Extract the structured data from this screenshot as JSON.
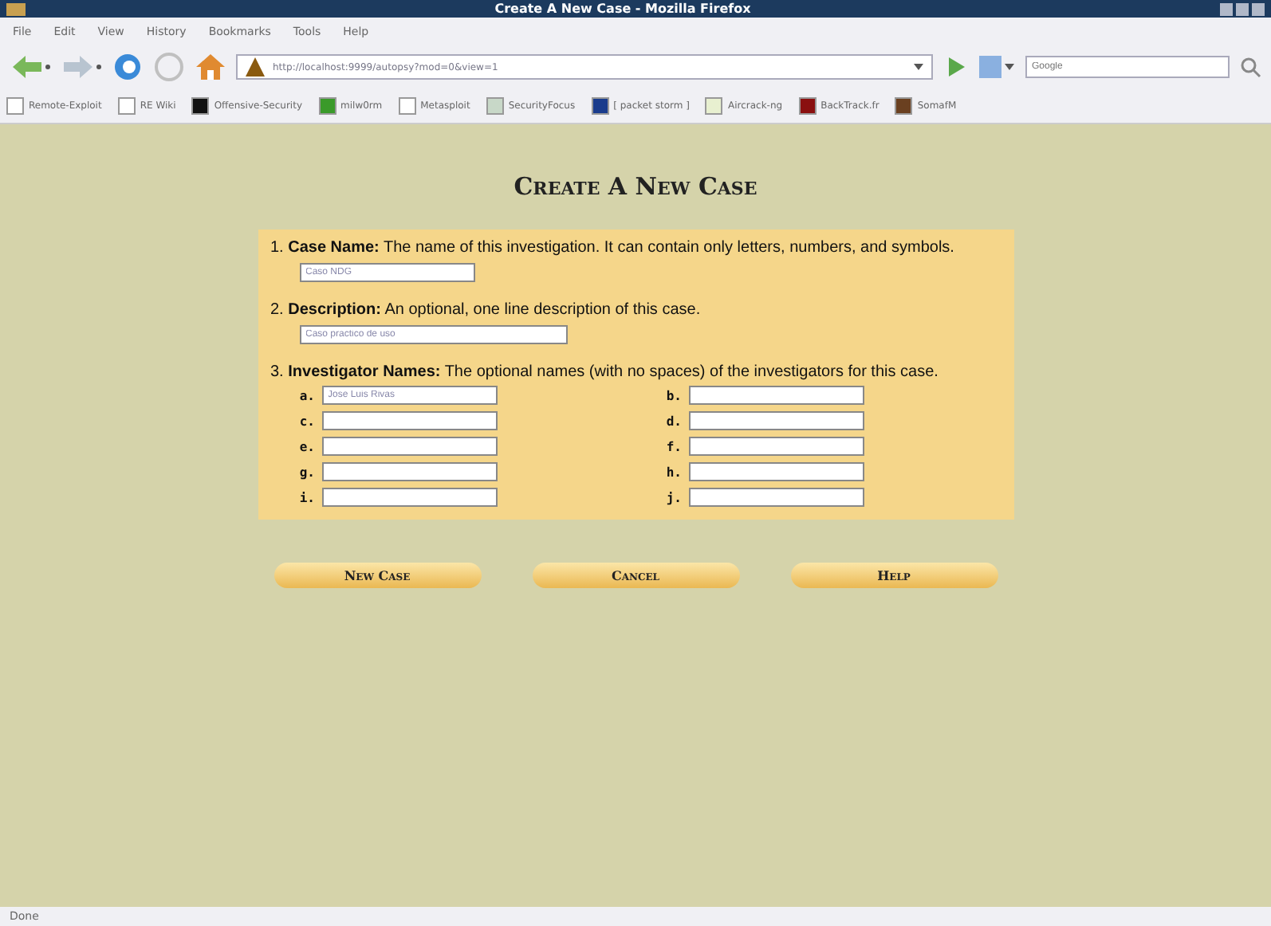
{
  "window": {
    "title": "Create A New Case - Mozilla Firefox"
  },
  "menu": [
    "File",
    "Edit",
    "View",
    "History",
    "Bookmarks",
    "Tools",
    "Help"
  ],
  "address": {
    "value": "http://localhost:9999/autopsy?mod=0&view=1"
  },
  "search": {
    "placeholder": "Google"
  },
  "bookmarks": [
    {
      "label": "Remote-Exploit",
      "kind": "page"
    },
    {
      "label": "RE Wiki",
      "kind": "page"
    },
    {
      "label": "Offensive-Security",
      "kind": "dark"
    },
    {
      "label": "milw0rm",
      "kind": "green"
    },
    {
      "label": "Metasploit",
      "kind": "page"
    },
    {
      "label": "SecurityFocus",
      "kind": "focus"
    },
    {
      "label": "[ packet storm ]",
      "kind": "blue"
    },
    {
      "label": "Aircrack-ng",
      "kind": "aircrack"
    },
    {
      "label": "BackTrack.fr",
      "kind": "red"
    },
    {
      "label": "SomafM",
      "kind": "brown"
    }
  ],
  "heading": "Create A New Case",
  "sections": [
    {
      "number": "1.",
      "title": "Case Name:",
      "text": "The name of this investigation. It can contain only letters, numbers, and symbols.",
      "value": "Caso NDG",
      "kind": "short"
    },
    {
      "number": "2.",
      "title": "Description:",
      "text": "An optional, one line description of this case.",
      "value": "Caso practico de uso",
      "kind": "long"
    },
    {
      "number": "3.",
      "title": "Investigator Names:",
      "text": "The optional names (with no spaces) of the investigators for this case.",
      "kind": "names"
    }
  ],
  "investigators": [
    {
      "label": "a.",
      "value": "Jose Luis Rivas"
    },
    {
      "label": "b."
    },
    {
      "label": "c."
    },
    {
      "label": "d."
    },
    {
      "label": "e."
    },
    {
      "label": "f."
    },
    {
      "label": "g."
    },
    {
      "label": "h."
    },
    {
      "label": "i."
    },
    {
      "label": "j."
    }
  ],
  "buttons": [
    "New Case",
    "Cancel",
    "Help"
  ],
  "status_bar": "Done"
}
